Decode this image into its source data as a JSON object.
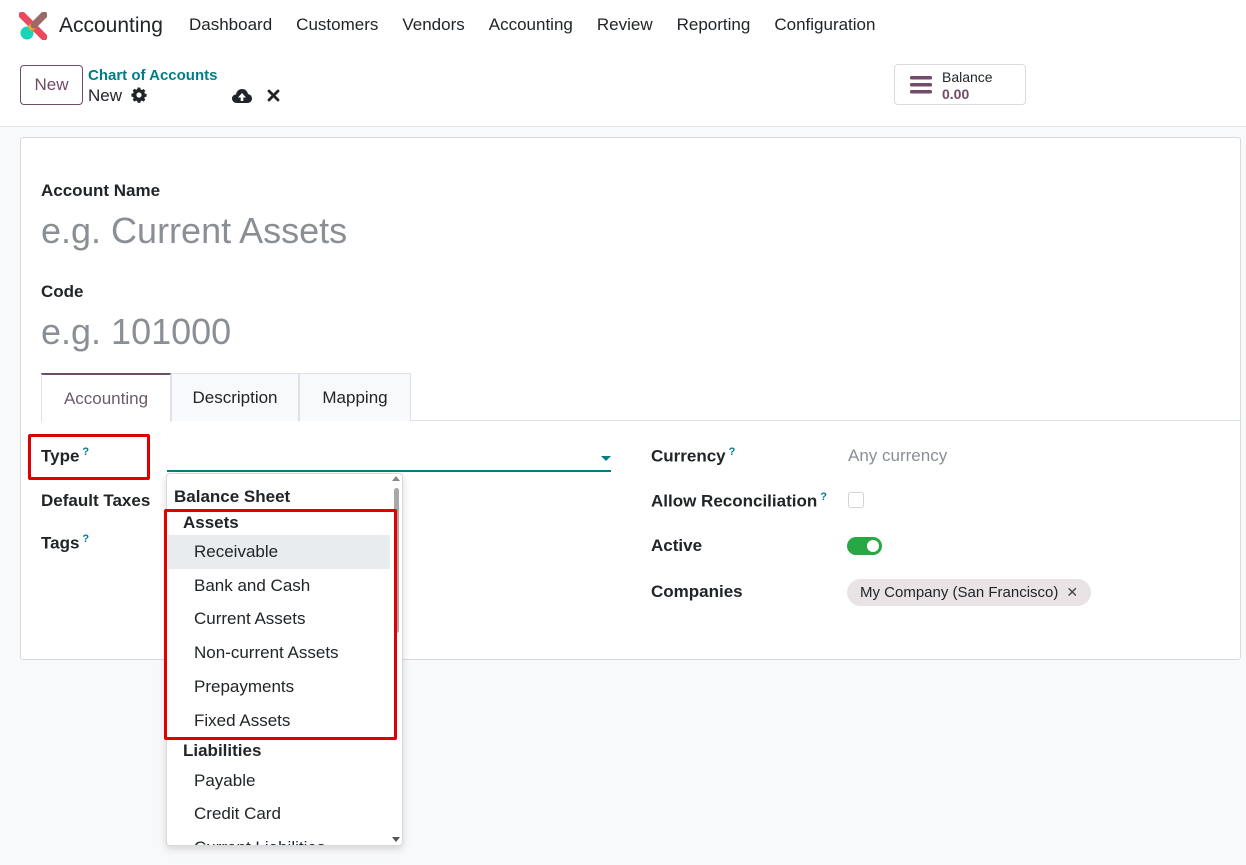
{
  "app": {
    "name": "Accounting"
  },
  "nav": [
    "Dashboard",
    "Customers",
    "Vendors",
    "Accounting",
    "Review",
    "Reporting",
    "Configuration"
  ],
  "control": {
    "new_label": "New",
    "breadcrumb_parent": "Chart of Accounts",
    "breadcrumb_current": "New"
  },
  "balance": {
    "label": "Balance",
    "value": "0.00"
  },
  "form": {
    "account_name_label": "Account Name",
    "account_name_placeholder": "e.g. Current Assets",
    "code_label": "Code",
    "code_placeholder": "e.g. 101000",
    "tabs": [
      "Accounting",
      "Description",
      "Mapping"
    ],
    "type_label": "Type",
    "help_mark": "?",
    "default_taxes_label": "Default Taxes",
    "tags_label": "Tags",
    "currency_label": "Currency",
    "currency_value": "Any currency",
    "allow_reconciliation_label": "Allow Reconciliation",
    "active_label": "Active",
    "active_value": true,
    "companies_label": "Companies",
    "company_tag": "My Company (San Francisco)",
    "tag_remove": "✕"
  },
  "dropdown": {
    "section": "Balance Sheet",
    "groups": [
      {
        "label": "Assets",
        "items": [
          "Receivable",
          "Bank and Cash",
          "Current Assets",
          "Non-current Assets",
          "Prepayments",
          "Fixed Assets"
        ]
      },
      {
        "label": "Liabilities",
        "items": [
          "Payable",
          "Credit Card",
          "Current Liabilities"
        ]
      }
    ],
    "hovered_item": "Receivable"
  },
  "colors": {
    "brand": "#714b67",
    "teal": "#017e84",
    "active_toggle": "#28a745",
    "highlight_red": "#e00000"
  }
}
